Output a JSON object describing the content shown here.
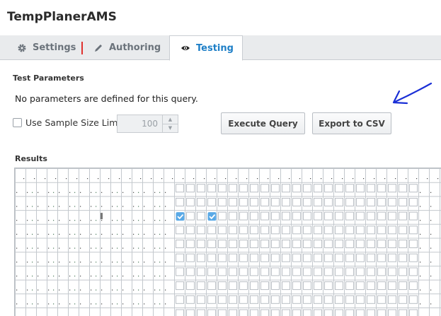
{
  "window": {
    "title": "TempPlanerAMS"
  },
  "tabs": [
    {
      "label": "Settings",
      "icon": "gear-icon",
      "active": false
    },
    {
      "label": "Authoring",
      "icon": "pencil-icon",
      "active": false
    },
    {
      "label": "Testing",
      "icon": "eye-icon",
      "active": true
    }
  ],
  "test_parameters": {
    "heading": "Test Parameters",
    "message": "No parameters are defined for this query.",
    "sample_limit_label": "Use Sample Size Limit",
    "sample_limit_checked": false,
    "sample_limit_value": "100",
    "execute_label": "Execute Query",
    "export_label": "Export to CSV"
  },
  "results": {
    "heading": "Results",
    "checked_cells": [
      {
        "row": 3,
        "col": 15
      },
      {
        "row": 3,
        "col": 18
      }
    ]
  },
  "colors": {
    "accent": "#1e7fc7",
    "tab_separator": "#e0312e",
    "annotation": "#1a2fd6",
    "checkbox_checked": "#5aa9e6"
  }
}
